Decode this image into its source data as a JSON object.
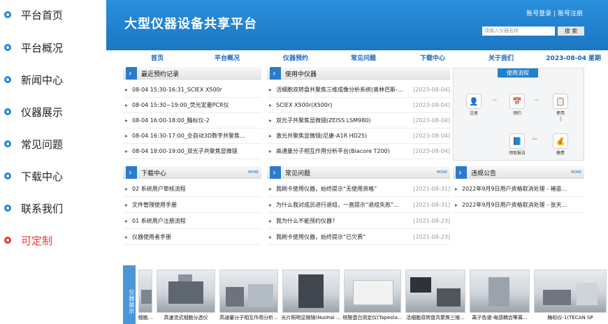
{
  "left_menu": {
    "items": [
      {
        "label": "平台首页"
      },
      {
        "label": "平台概况"
      },
      {
        "label": "新闻中心"
      },
      {
        "label": "仪器展示"
      },
      {
        "label": "常见问题"
      },
      {
        "label": "下载中心"
      },
      {
        "label": "联系我们"
      },
      {
        "label": "可定制"
      }
    ]
  },
  "header": {
    "title": "大型仪器设备共享平台",
    "login_label": "账号登录",
    "separator": "|",
    "register_label": "账号注册",
    "search_placeholder": "请输入仪器名称",
    "search_button": "搜 索"
  },
  "nav": {
    "items": [
      {
        "label": "首页"
      },
      {
        "label": "平台概况"
      },
      {
        "label": "仪器预约"
      },
      {
        "label": "常见问题"
      },
      {
        "label": "下载中心"
      },
      {
        "label": "关于我们"
      }
    ],
    "date": "2023-08-04 星期"
  },
  "recent_bookings": {
    "title": "最近预约记录",
    "rows": [
      {
        "text": "08-04 15:30-16:31_SCIEX X500r"
      },
      {
        "text": "08-04 15:30~19:00_荧光定量PCR仪"
      },
      {
        "text": "08-04 16:00-18:00_酶标仪-2"
      },
      {
        "text": "08-04 16:30-17:00_全自动3D数字共聚焦..."
      },
      {
        "text": "08-04 18:00-19:00_双光子共聚焦显微镜"
      }
    ]
  },
  "in_use": {
    "title": "使用中仪器",
    "rows": [
      {
        "text": "活细胞双转盘共聚焦三维成像分析系统(奥林巴斯-...",
        "date": "[2023-08-04]"
      },
      {
        "text": "SCIEX X500r(X500r)",
        "date": "[2023-08-04]"
      },
      {
        "text": "双光子共聚焦显微镜(ZEISS LSM980)",
        "date": "[2023-08-04]"
      },
      {
        "text": "激光共聚焦显微镜(尼康-A1R HD25)",
        "date": "[2023-08-04]"
      },
      {
        "text": "高通量分子相互作用分析平台(Biacore T200)",
        "date": "[2023-08-04]"
      }
    ]
  },
  "flow": {
    "title": "使用流程",
    "steps": [
      {
        "label": "注册",
        "icon": "user-icon"
      },
      {
        "label": "预约",
        "icon": "calendar-icon"
      },
      {
        "label": "使用",
        "icon": "clipboard-icon"
      },
      {
        "label": "缴费",
        "icon": "coins-icon"
      },
      {
        "label": "领取报告",
        "icon": "report-icon"
      }
    ]
  },
  "downloads": {
    "title": "下载中心",
    "more": "MORE",
    "rows": [
      {
        "text": "02 系统用户审核流程"
      },
      {
        "text": "文件管理使用手册"
      },
      {
        "text": "01 系统用户注册流程"
      },
      {
        "text": "仪器使用者手册"
      }
    ]
  },
  "faq": {
    "title": "常见问题",
    "more": "MORE",
    "rows": [
      {
        "text": "我刷卡使用仪器，始终提示“无使用资格”",
        "date": "[2021-08-31]"
      },
      {
        "text": "为什么我对成员进行退组，一直提示“退组失败”...",
        "date": "[2021-08-31]"
      },
      {
        "text": "我为什么不能预约仪器?",
        "date": "[2021-08-23]"
      },
      {
        "text": "我刷卡使用仪器，始终提示“已欠费”",
        "date": "[2021-08-23]"
      }
    ]
  },
  "notices": {
    "title": "违规公告",
    "more": "MORE",
    "rows": [
      {
        "text": "2022年9月9日用户资格取消处理 - 褚苗..."
      },
      {
        "text": "2022年9月9日用户资格取消处理 - 张天..."
      }
    ]
  },
  "gallery": {
    "tab_label": "仪器展示",
    "items": [
      {
        "caption": "细胞..."
      },
      {
        "caption": "高速流式细胞分选仪"
      },
      {
        "caption": "高通量分子相互作用分析..."
      },
      {
        "caption": "光片照明显微镜(Nuohai ..."
      },
      {
        "caption": "核酸蛋白测定仪(Tapesta..."
      },
      {
        "caption": "活细胞双转盘共聚焦三维..."
      },
      {
        "caption": "离子色谱-电感耦合等离..."
      },
      {
        "caption": "酶标仪-1(TECAN SP"
      }
    ]
  },
  "colors": {
    "accent": "#1f82d0",
    "highlight_red": "#e53935",
    "link_blue": "#1a67b8"
  }
}
